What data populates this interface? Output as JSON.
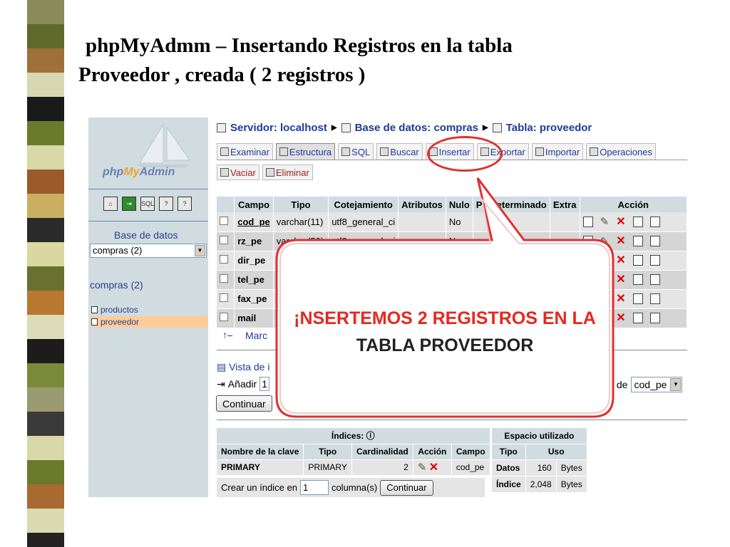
{
  "slide": {
    "title_line1": "phpMyAdmm  – Insertando Registros en la tabla",
    "title_line2": "Proveedor , creada ( 2 registros )"
  },
  "sidebar": {
    "logo": "phpMyAdmin",
    "db_label": "Base de datos",
    "db_select": "compras (2)",
    "db_link": "compras (2)",
    "tables": [
      "productos",
      "proveedor"
    ]
  },
  "breadcrumb": {
    "server": "Servidor: localhost",
    "database": "Base de datos: compras",
    "table": "Tabla: proveedor"
  },
  "tabs": [
    "Examinar",
    "Estructura",
    "SQL",
    "Buscar",
    "Insertar",
    "Exportar",
    "Importar",
    "Operaciones"
  ],
  "tabs2": [
    "Vaciar",
    "Eliminar"
  ],
  "structure": {
    "headers": [
      "Campo",
      "Tipo",
      "Cotejamiento",
      "Atributos",
      "Nulo",
      "Predeterminado",
      "Extra",
      "Acción"
    ],
    "rows": [
      {
        "campo": "cod_pe",
        "tipo": "varchar(11)",
        "cotejamiento": "utf8_general_ci",
        "nulo": "No"
      },
      {
        "campo": "rz_pe",
        "tipo": "varchar(50)",
        "cotejamiento": "utf8_general_ci",
        "nulo": "No"
      },
      {
        "campo": "dir_pe",
        "tipo": "",
        "cotejamiento": "",
        "nulo": ""
      },
      {
        "campo": "tel_pe",
        "tipo": "",
        "cotejamiento": "",
        "nulo": ""
      },
      {
        "campo": "fax_pe",
        "tipo": "",
        "cotejamiento": "",
        "nulo": ""
      },
      {
        "campo": "mail",
        "tipo": "",
        "cotejamiento": "",
        "nulo": ""
      }
    ]
  },
  "marcar": "Marc",
  "vista": "Vista de i",
  "anadir": {
    "label": "Añadir",
    "value": "1",
    "despues": "s de",
    "despues_value": "cod_pe"
  },
  "continuar": "Continuar",
  "indices": {
    "title": "Índices:",
    "headers": [
      "Nombre de la clave",
      "Tipo",
      "Cardinalidad",
      "Acción",
      "Campo"
    ],
    "row": {
      "nombre": "PRIMARY",
      "tipo": "PRIMARY",
      "cardinalidad": "2",
      "campo": "cod_pe"
    },
    "crear_label": "Crear un índice en",
    "crear_value": "1",
    "columnas": "columna(s)",
    "continuar": "Continuar"
  },
  "espacio": {
    "title": "Espacio utilizado",
    "headers": [
      "Tipo",
      "Uso"
    ],
    "rows": [
      {
        "tipo": "Datos",
        "valor": "160",
        "unidad": "Bytes"
      },
      {
        "tipo": "Índice",
        "valor": "2,048",
        "unidad": "Bytes"
      }
    ]
  },
  "callout": {
    "line1": "¡NSERTEMOS 2 REGISTROS EN LA",
    "line2": "TABLA PROVEEDOR"
  },
  "colors": {
    "accent_red": "#e8271e",
    "link_blue": "#1f3a9c",
    "header_bg": "#d0dce0"
  }
}
